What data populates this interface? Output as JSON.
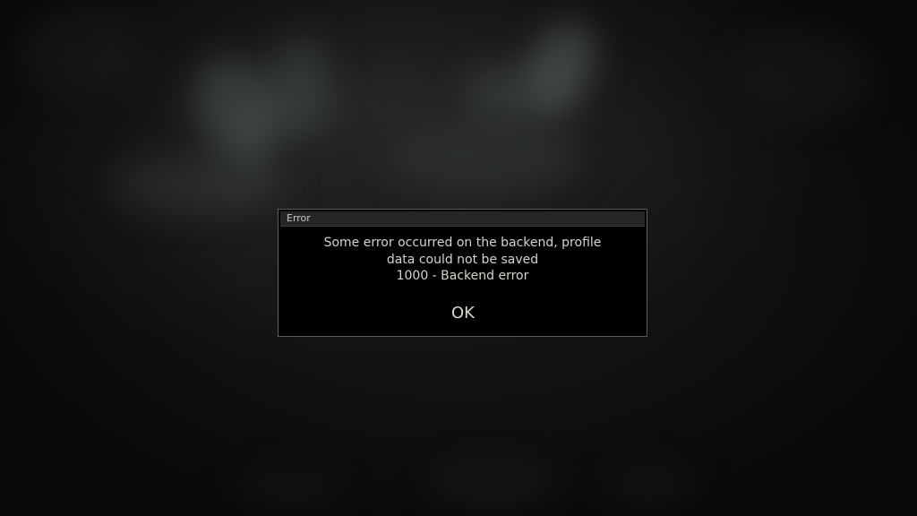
{
  "dialog": {
    "title": "Error",
    "message_lines": [
      "Some error occurred on the backend, profile",
      "data could not be saved",
      "1000 - Backend error"
    ],
    "ok_label": "OK"
  },
  "colors": {
    "background": "#121312",
    "dialog_background": "#000000",
    "dialog_border": "#5a5d5a",
    "header_background": "#252725",
    "text": "#d4d4cc"
  }
}
